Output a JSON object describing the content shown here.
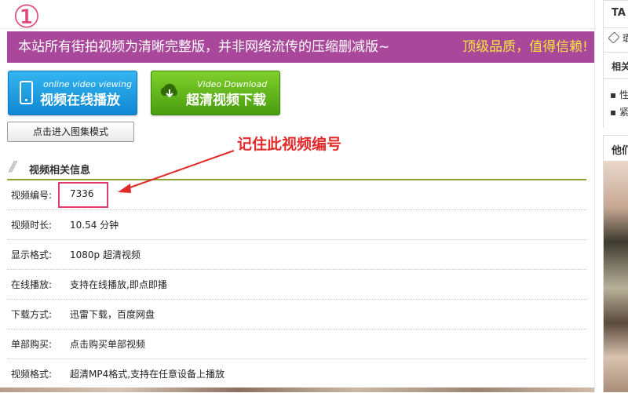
{
  "step_mark": "①",
  "banner": {
    "left_text": "本站所有街拍视频为清晰完整版，并非网络流传的压缩删减版~",
    "right_text": "顶级品质，值得信赖!"
  },
  "buttons": {
    "online": {
      "en": "online video viewing",
      "cn": "视频在线播放",
      "icon": "phone-icon"
    },
    "download": {
      "en": "Video Download",
      "cn": "超清视频下载",
      "icon": "cloud-download-icon"
    },
    "gallery": "点击进入图集模式"
  },
  "annotation": {
    "text": "记住此视频编号",
    "color": "#e22a2a"
  },
  "section_title": "视频相关信息",
  "info_rows": [
    {
      "label": "视频编号:",
      "value": "7336"
    },
    {
      "label": "视频时长:",
      "value": "10.54 分钟"
    },
    {
      "label": "显示格式:",
      "value": "1080p 超清视频"
    },
    {
      "label": "在线播放:",
      "value": "支持在线播放,即点即播"
    },
    {
      "label": "下载方式:",
      "value": "迅雷下载，百度网盘"
    },
    {
      "label": "单部购买:",
      "value": "点击购买单部视频"
    },
    {
      "label": "视频格式:",
      "value": "超清MP4格式,支持在任意设备上播放"
    }
  ],
  "sidebar": {
    "panel1_title": "TA",
    "tag_text": "璐",
    "related_title": "相关",
    "related_items": [
      "性",
      "紧"
    ],
    "panel2_title": "他们"
  },
  "colors": {
    "banner_bg": "#a9489b",
    "banner_accent": "#f6e73f",
    "highlight": "#e23b6c",
    "section_rule": "#8ea32c"
  }
}
